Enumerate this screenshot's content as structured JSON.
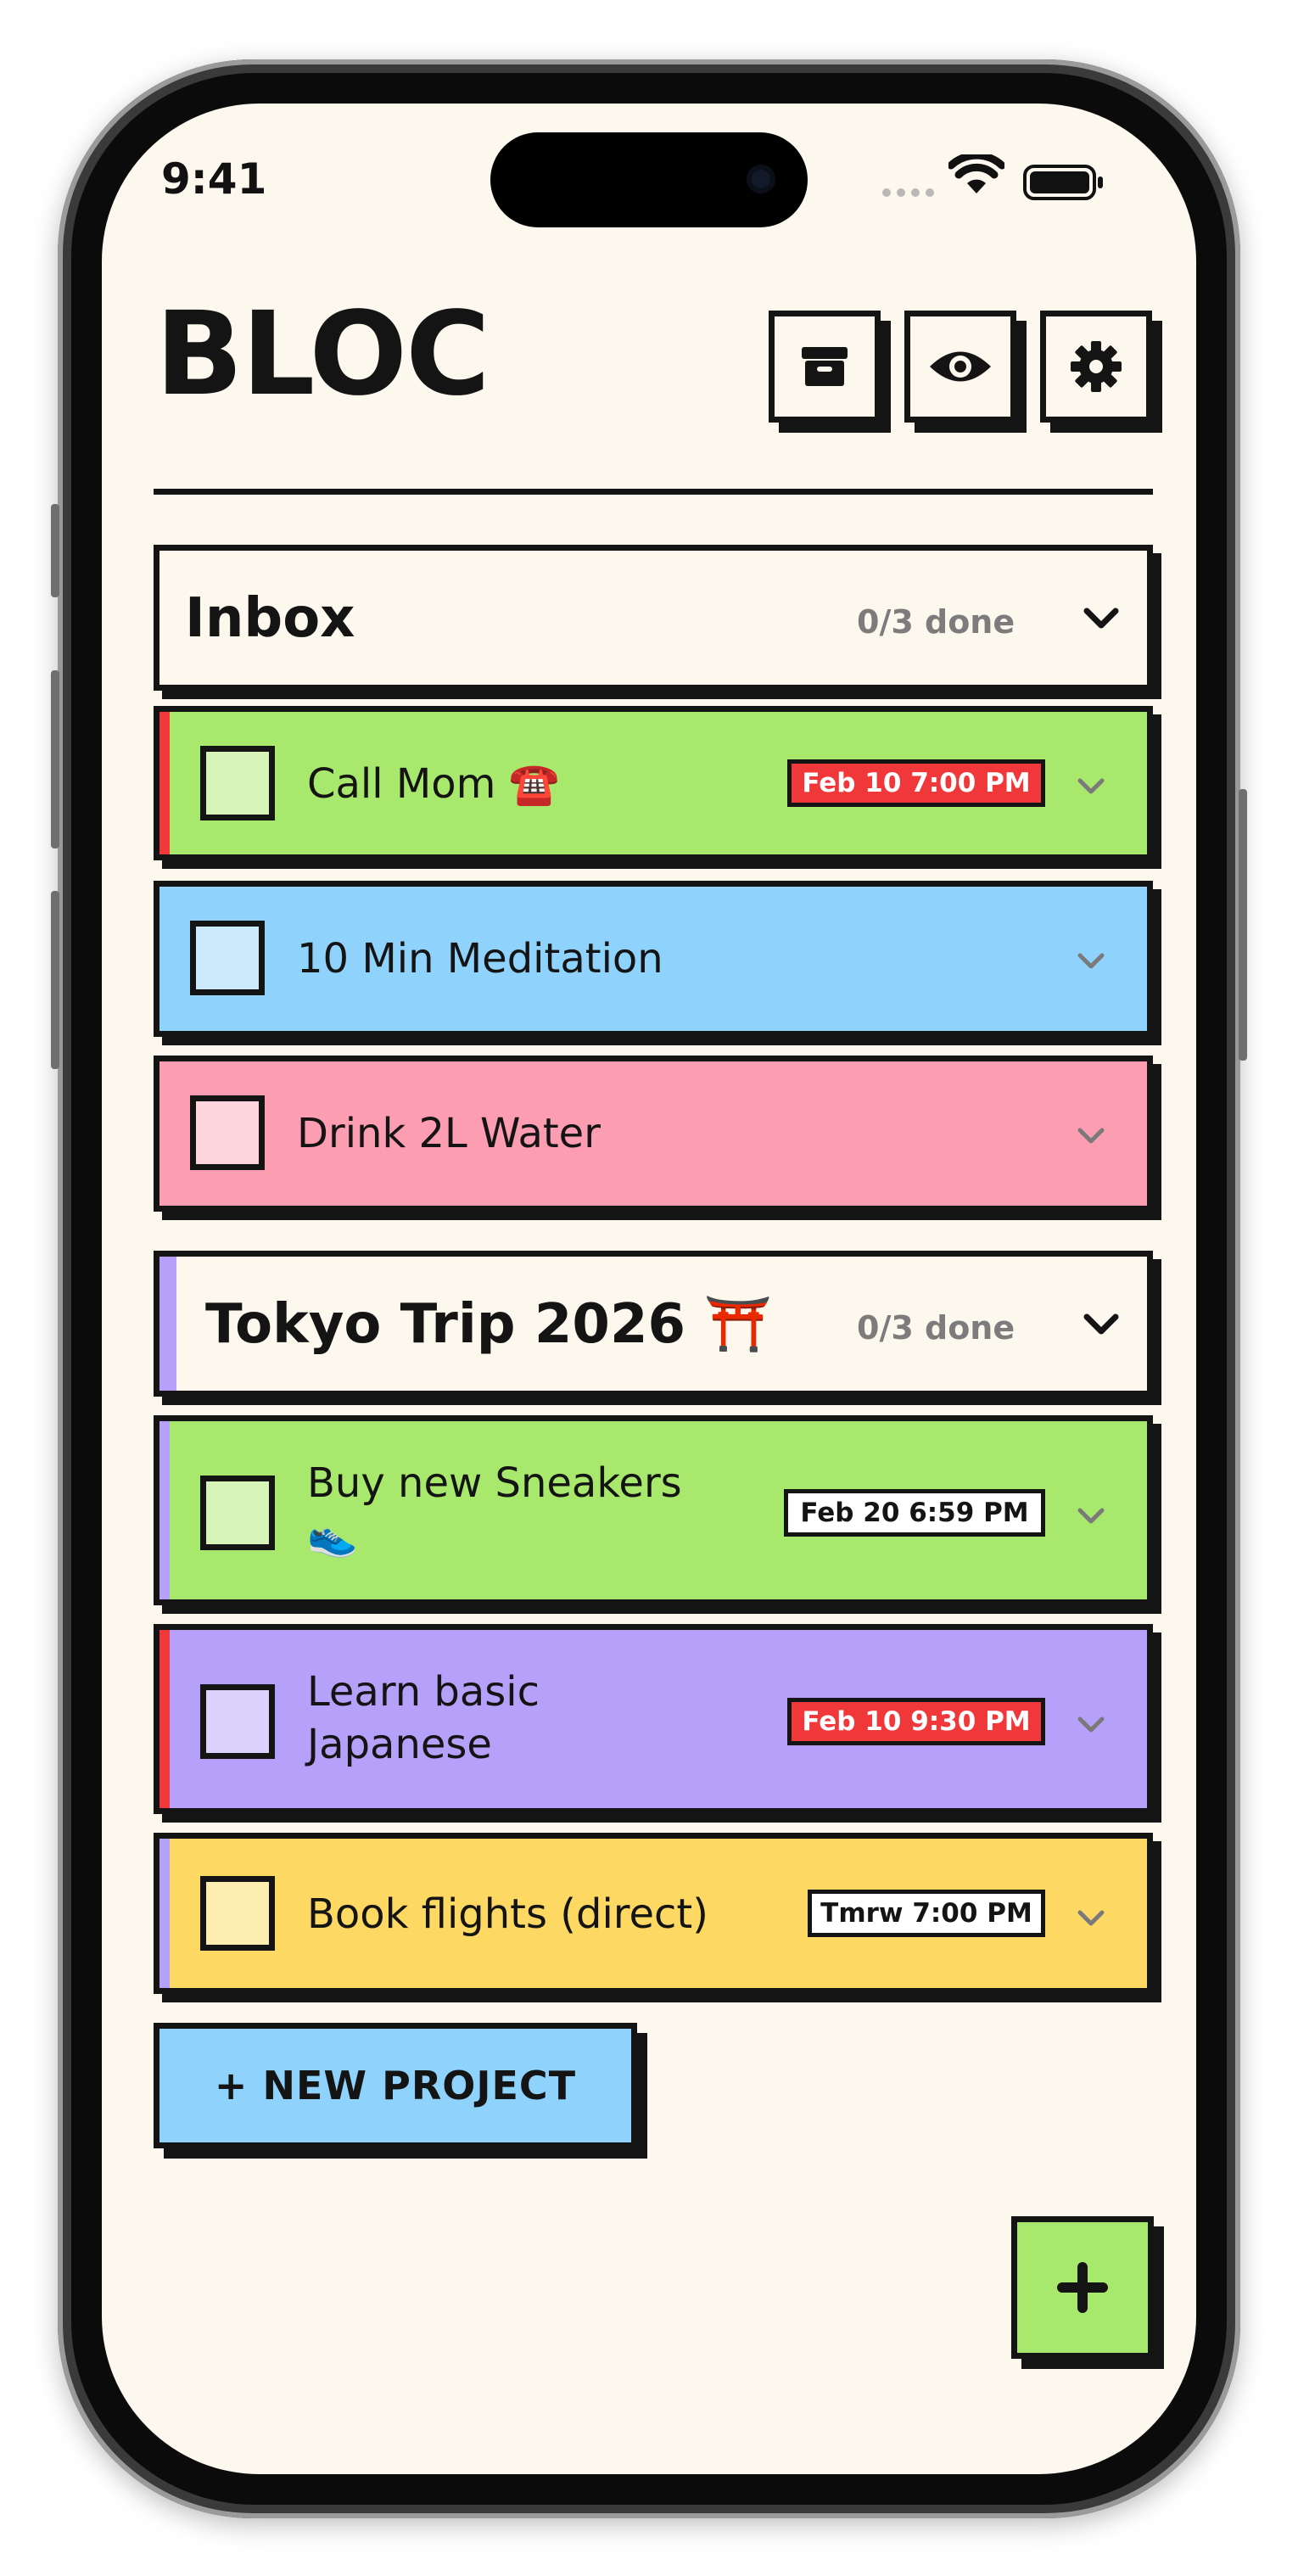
{
  "status_bar": {
    "time": "9:41"
  },
  "header": {
    "app_title": "BLOC",
    "buttons": [
      {
        "icon": "archive-icon"
      },
      {
        "icon": "eye-icon"
      },
      {
        "icon": "gear-icon"
      }
    ]
  },
  "projects": [
    {
      "title": "Inbox",
      "count": "0/3 done",
      "accent": null,
      "tasks": [
        {
          "title": "Call Mom ☎️",
          "due": "Feb 10 7:00 PM",
          "overdue": true,
          "color": "#a8e86c",
          "check_color": "#d6f3b8",
          "stripe": "#f0383b"
        },
        {
          "title": "10 Min Meditation",
          "due": null,
          "overdue": false,
          "color": "#8fd3fd",
          "check_color": "#cdeafd",
          "stripe": null
        },
        {
          "title": "Drink 2L Water",
          "due": null,
          "overdue": false,
          "color": "#fd9db2",
          "check_color": "#fed4dd",
          "stripe": null
        }
      ]
    },
    {
      "title": "Tokyo Trip 2026 ⛩️",
      "count": "0/3 done",
      "accent": "#b6a1fa",
      "tasks": [
        {
          "title": "Buy new Sneakers 👟",
          "due": "Feb 20 6:59 PM",
          "overdue": false,
          "color": "#a8e86c",
          "check_color": "#d6f3b8",
          "stripe": "#b6a1fa"
        },
        {
          "title": "Learn basic Japanese",
          "due": "Feb 10 9:30 PM",
          "overdue": true,
          "color": "#b6a1fa",
          "check_color": "#ddd2fd",
          "stripe": "#f0383b"
        },
        {
          "title": "Book flights (direct)",
          "due": "Tmrw 7:00 PM",
          "overdue": false,
          "color": "#fdd862",
          "check_color": "#feedb0",
          "stripe": "#b6a1fa"
        }
      ]
    }
  ],
  "new_project_label": "+ NEW PROJECT",
  "colors": {
    "background": "#fcf8ee",
    "ink": "#141414",
    "overdue": "#f0383b",
    "muted": "#7c7c7c"
  }
}
